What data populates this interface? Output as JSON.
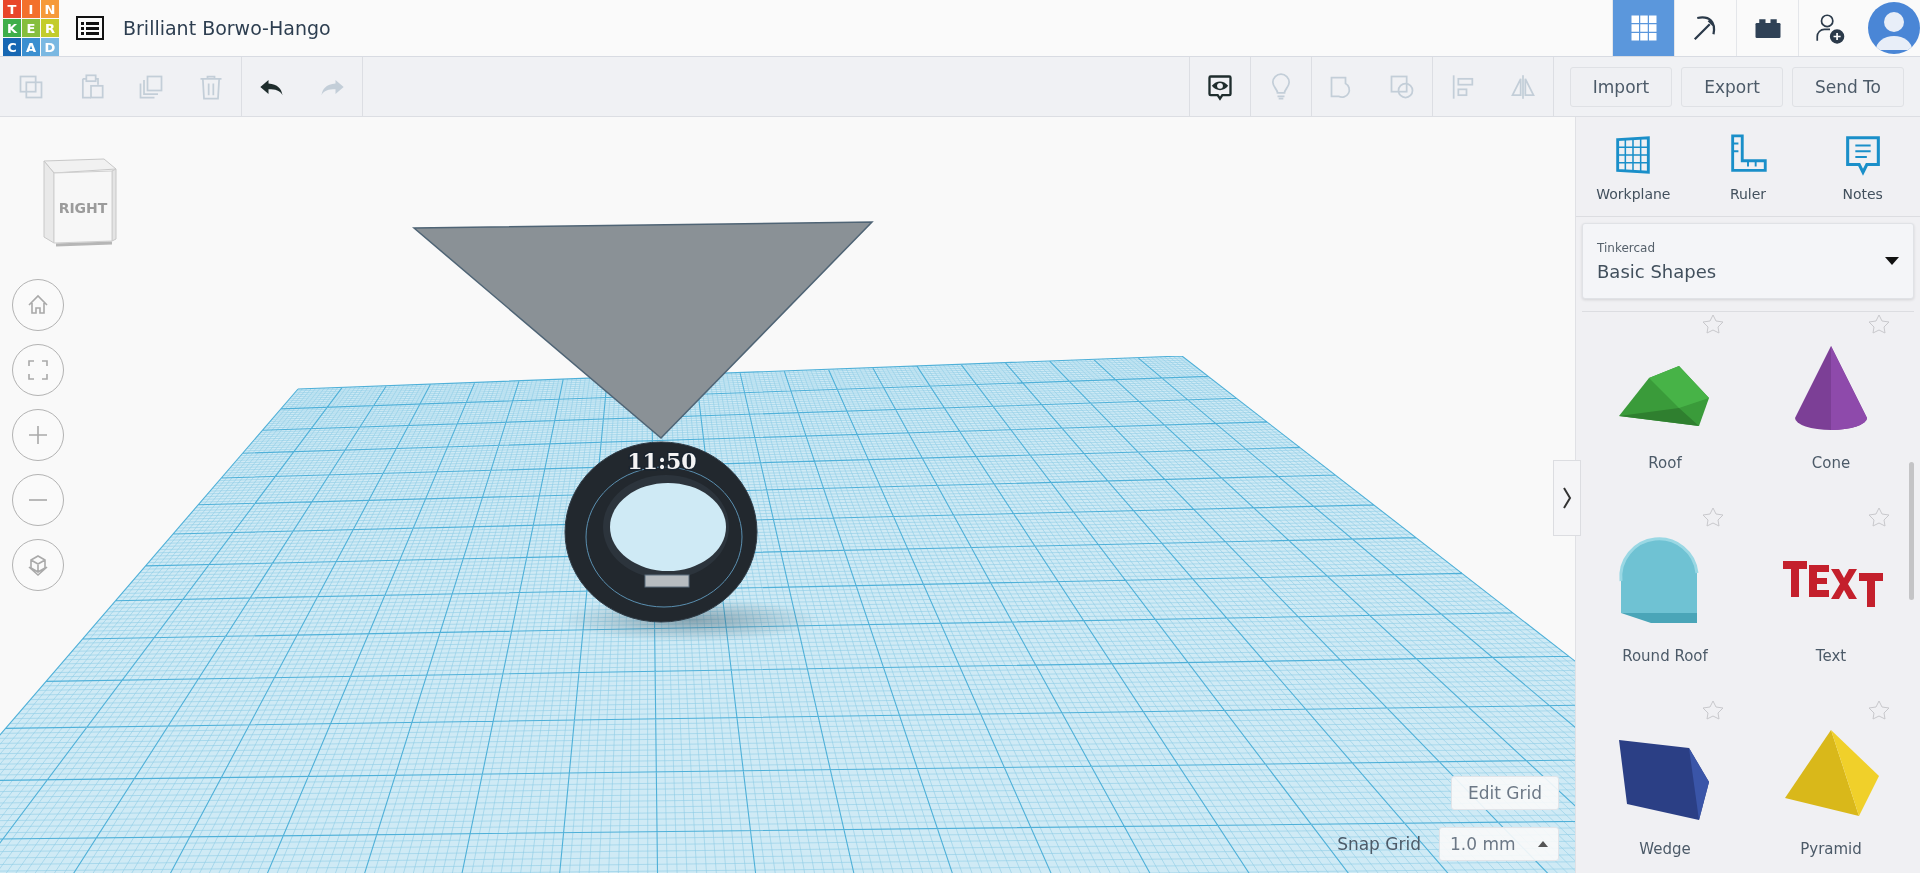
{
  "app": {
    "logo_letters": [
      "T",
      "I",
      "N",
      "K",
      "E",
      "R",
      "C",
      "A",
      "D"
    ],
    "title": "Brilliant Borwo-Hango"
  },
  "mode_buttons": [
    {
      "kind": "grid",
      "selected": true
    },
    {
      "kind": "pickaxe",
      "selected": false
    },
    {
      "kind": "bricks",
      "selected": false
    }
  ],
  "toolbar": {
    "edit_tools": [
      {
        "kind": "copy",
        "disabled": true
      },
      {
        "kind": "paste",
        "disabled": true
      },
      {
        "kind": "duplicate",
        "disabled": true
      },
      {
        "kind": "delete",
        "disabled": true
      }
    ],
    "history": [
      {
        "kind": "undo",
        "disabled": false
      },
      {
        "kind": "redo",
        "disabled": true
      }
    ],
    "shape_tool_groups": [
      [
        {
          "kind": "notes-visibility",
          "disabled": false
        }
      ],
      [
        {
          "kind": "bulb",
          "disabled": true
        }
      ],
      [
        {
          "kind": "group",
          "disabled": true
        },
        {
          "kind": "ungroup",
          "disabled": true
        }
      ],
      [
        {
          "kind": "align",
          "disabled": true
        },
        {
          "kind": "mirror",
          "disabled": true
        }
      ]
    ],
    "buttons": [
      "Import",
      "Export",
      "Send To"
    ]
  },
  "view_cube": {
    "face_label": "RIGHT"
  },
  "view_controls": [
    {
      "kind": "home"
    },
    {
      "kind": "fit"
    },
    {
      "kind": "zoom-in"
    },
    {
      "kind": "zoom-out"
    },
    {
      "kind": "perspective"
    }
  ],
  "scene": {
    "ring_text": "11:50"
  },
  "grid_controls": {
    "edit_button": "Edit Grid",
    "snap_label": "Snap Grid",
    "snap_value": "1.0 mm"
  },
  "panel": {
    "tools": [
      {
        "kind": "workplane",
        "label": "Workplane"
      },
      {
        "kind": "ruler",
        "label": "Ruler"
      },
      {
        "kind": "notes",
        "label": "Notes"
      }
    ],
    "library": {
      "source": "Tinkercad",
      "category": "Basic Shapes"
    },
    "shapes": [
      {
        "kind": "roof",
        "name": "Roof"
      },
      {
        "kind": "cone",
        "name": "Cone"
      },
      {
        "kind": "round-roof",
        "name": "Round Roof"
      },
      {
        "kind": "text",
        "name": "Text"
      },
      {
        "kind": "wedge",
        "name": "Wedge"
      },
      {
        "kind": "pyramid",
        "name": "Pyramid"
      }
    ]
  }
}
